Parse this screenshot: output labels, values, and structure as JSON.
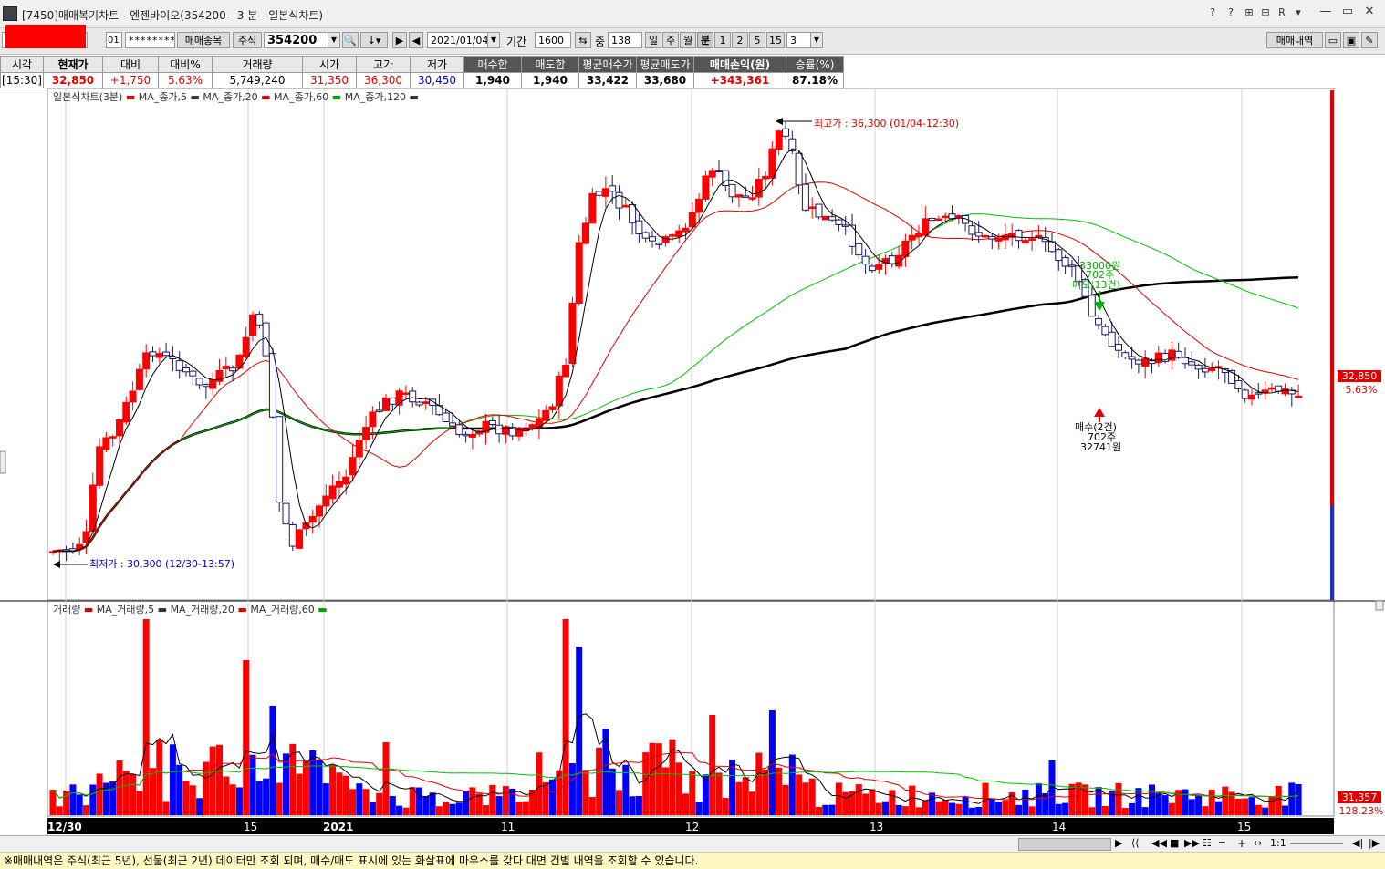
{
  "window": {
    "title": "[7450]매매복기차트 - 엔젠바이오(354200 - 3 분 - 일본식차트)",
    "controls": [
      "?",
      "?",
      "⊞",
      "R",
      "▾",
      "—",
      "▭",
      "✕"
    ]
  },
  "toolbar": {
    "account_no": "01",
    "password": "********",
    "trade_items_label": "매매종목",
    "market": "주식",
    "stock_code": "354200",
    "date": "2021/01/04",
    "period_label": "기간",
    "period_value": "1600",
    "count_prefix": "중",
    "count_value": "138",
    "periods": [
      "일",
      "주",
      "월",
      "분"
    ],
    "selected_period": "분",
    "minutes": [
      "1",
      "2",
      "5",
      "15"
    ],
    "minute_value": "3",
    "trade_history_label": "매매내역"
  },
  "info": {
    "headers": [
      "시각",
      "현재가",
      "대비",
      "대비%",
      "거래량",
      "시가",
      "고가",
      "저가",
      "매수합",
      "매도합",
      "평균매수가",
      "평균매도가",
      "매매손익(원)",
      "승률(%)"
    ],
    "values": [
      "[15:30]",
      "32,850",
      "+1,750",
      "5.63%",
      "5,749,240",
      "31,350",
      "36,300",
      "30,450",
      "1,940",
      "1,940",
      "33,422",
      "33,680",
      "+343,361",
      "87.18%"
    ]
  },
  "price_chart": {
    "legend_title": "일본식차트(3분)",
    "ma_labels": [
      "MA_종가,5",
      "MA_종가,20",
      "MA_종가,60",
      "MA_종가,120"
    ],
    "high_annotation": "최고가 : 36,300 (01/04-12:30)",
    "low_annotation": "최저가 : 30,300 (12/30-13:57)",
    "sell_annotation": [
      "매도(13건)",
      "702주",
      "33000원"
    ],
    "buy_annotation": [
      "매수(2건)",
      "702주",
      "32741원"
    ],
    "last_price": "32,850",
    "last_change": "5.63%"
  },
  "volume_chart": {
    "legend_title": "거래량",
    "ma_labels": [
      "MA_거래량,5",
      "MA_거래량,20",
      "MA_거래량,60"
    ],
    "last_volume": "31,357",
    "last_ratio": "128.23%"
  },
  "date_axis": [
    "12/30",
    "15",
    "2021",
    "11",
    "12",
    "13",
    "14",
    "15"
  ],
  "scroll": {
    "ratio": "1:1"
  },
  "status_text": "※매매내역은 주식(최근 5년), 선물(최근 2년) 데이터만 조회 되며, 매수/매도 표시에 있는 화살표에 마우스를 갖다 대면 건별 내역을 조회할 수 있습니다.",
  "colors": {
    "up": "#ff0000",
    "down": "#0000ff",
    "ma5": "#000000",
    "ma20": "#e00000",
    "ma60": "#00c000",
    "ma120": "#000000"
  }
}
